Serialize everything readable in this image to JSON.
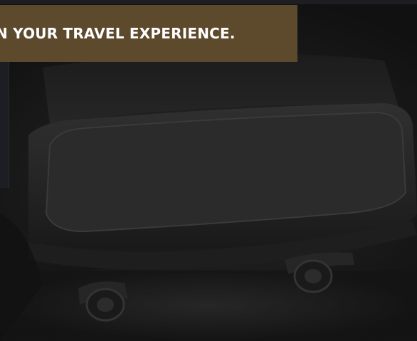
{
  "hero": {
    "banner_text": "N YOUR TRAVEL EXPERIENCE.",
    "image_label": "suitcase-image"
  },
  "colors": {
    "banner_bg": "#5d4a2d",
    "banner_text": "#ffffff",
    "background": "#151515"
  }
}
